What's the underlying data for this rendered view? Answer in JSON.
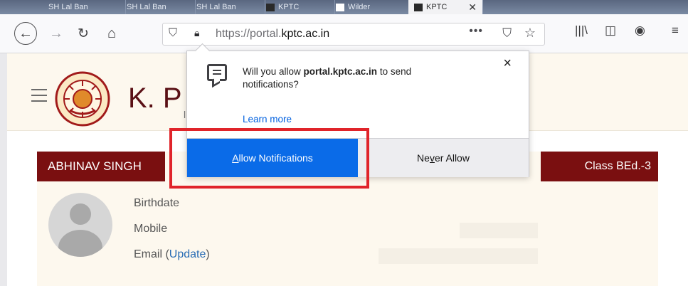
{
  "tabs": [
    "SH Lal Ban",
    "SH Lal Ban",
    "SH Lal Ban",
    "KPTC",
    "Wilder",
    "KPTC"
  ],
  "toolbar": {
    "url_prefix": "https://portal.",
    "url_domain": "kptc.ac.in",
    "icons": [
      "back-icon",
      "forward-icon",
      "reload-icon",
      "home-icon",
      "shield-icon",
      "lock-icon",
      "more-icon",
      "pocket-icon",
      "star-icon",
      "library-icon",
      "sidebar-icon",
      "account-icon",
      "menu-icon"
    ]
  },
  "site": {
    "title": "K. P",
    "title_suffix": "l",
    "student_name": "ABHINAV SINGH",
    "class_label": "Class BEd.-3",
    "fields": {
      "birthdate": "Birthdate",
      "mobile": "Mobile",
      "email": "Email",
      "email_link": "Update"
    }
  },
  "popup": {
    "message_prefix": "Will you allow ",
    "message_domain": "portal.kptc.ac.in",
    "message_suffix": " to send notifications?",
    "learn_more": "Learn more",
    "close": "×",
    "allow_label": {
      "pre": "",
      "underlined": "A",
      "post": "llow Notifications"
    },
    "never_label": {
      "pre": "Ne",
      "underlined": "v",
      "post": "er Allow"
    }
  },
  "colors": {
    "brand": "#7a0f10",
    "allow_button": "#0a6be8",
    "highlight": "#e0242a",
    "page_bg": "#fdf8ee"
  }
}
